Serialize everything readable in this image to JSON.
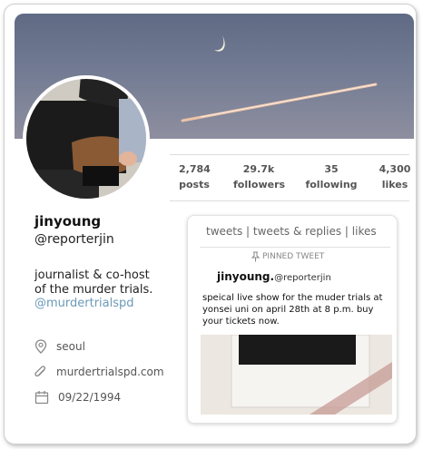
{
  "stats": [
    {
      "value": "2,784",
      "label": "posts"
    },
    {
      "value": "29.7k",
      "label": "followers"
    },
    {
      "value": "35",
      "label": "following"
    },
    {
      "value": "4,300",
      "label": "likes"
    }
  ],
  "profile": {
    "display_name": "jinyoung",
    "handle": "@reporterjin",
    "bio_line1": "journalist & co-host",
    "bio_line2": "of the murder trials.",
    "bio_link": "@murdertrialspd",
    "location": "seoul",
    "website": "murdertrialspd.com",
    "birthday": "09/22/1994"
  },
  "tweets_panel": {
    "tabs_text": "tweets | tweets & replies | likes",
    "pinned_label": "PINNED TWEET",
    "tweet_name": "jinyoung.",
    "tweet_handle": "@reporterjin",
    "tweet_text": "speical live show for the muder trials at yonsei uni on april 28th at 8 p.m. buy your tickets now."
  },
  "colors": {
    "link": "#6b9ab8",
    "banner_sky": "#6a7490"
  },
  "icons": {
    "location": "map-pin-icon",
    "website": "paperclip-icon",
    "birthday": "calendar-icon",
    "pinned": "pin-icon"
  }
}
